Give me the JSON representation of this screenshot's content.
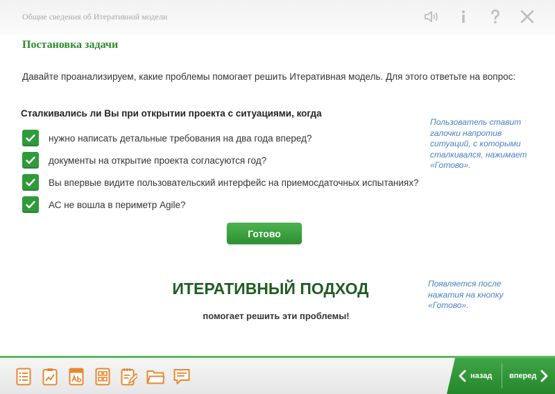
{
  "header": {
    "breadcrumb": "Общие сведения об Итеративной модели",
    "icons": [
      "sound-icon",
      "info-icon",
      "help-icon",
      "close-icon"
    ]
  },
  "content": {
    "section_title": "Постановка задачи",
    "intro": "Давайте проанализируем, какие проблемы помогает решить Итеративная модель. Для этого ответьте на вопрос:",
    "question": "Сталкивались ли Вы при открытии проекта с ситуациями, когда",
    "items": [
      {
        "label": "нужно написать детальные требования на два года вперед?",
        "checked": true
      },
      {
        "label": "документы на открытие проекта согласуются год?",
        "checked": true
      },
      {
        "label": "Вы впервые видите пользовательский интерфейс на приемосдаточных испытаниях?",
        "checked": true
      },
      {
        "label": "АС не вошла в периметр Agile?",
        "checked": true
      }
    ],
    "done_button": "Готово",
    "note_checkboxes": "Пользователь ставит галочки напротив ситуаций, с которыми сталкивался, нажимает «Готово».",
    "result_title": "ИТЕРАТИВНЫЙ ПОДХОД",
    "result_subtitle": "помогает решить эти проблемы!",
    "note_result": "Появляется после нажатия на кнопку «Готово»."
  },
  "footer": {
    "back": "назад",
    "forward": "вперед",
    "accent_color": "#3fa545"
  }
}
